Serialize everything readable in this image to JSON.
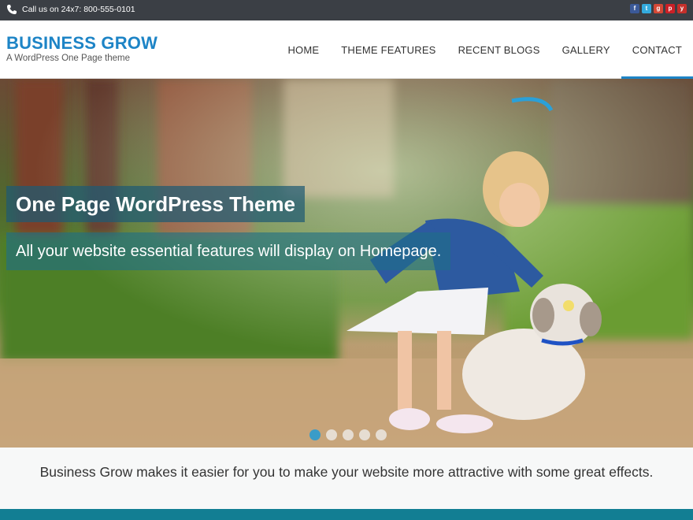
{
  "topbar": {
    "call_text": "Call us on  24x7: 800-555-0101",
    "phone_icon": "phone-icon",
    "social": [
      {
        "name": "facebook-icon",
        "glyph": "f",
        "color": "#3b5998"
      },
      {
        "name": "twitter-icon",
        "glyph": "t",
        "color": "#33aadd"
      },
      {
        "name": "google-plus-icon",
        "glyph": "g",
        "color": "#d34836"
      },
      {
        "name": "pinterest-icon",
        "glyph": "p",
        "color": "#cb2027"
      },
      {
        "name": "youtube-icon",
        "glyph": "y",
        "color": "#c4302b"
      }
    ]
  },
  "header": {
    "logo": "BUSINESS GROW",
    "tagline": "A WordPress One Page theme",
    "nav": [
      {
        "label": "HOME"
      },
      {
        "label": "THEME FEATURES"
      },
      {
        "label": "RECENT BLOGS"
      },
      {
        "label": "GALLERY"
      },
      {
        "label": "CONTACT"
      }
    ],
    "active_index": 4
  },
  "hero": {
    "caption_title": "One Page WordPress Theme",
    "caption_text": "All your website essential features will display on Homepage.",
    "slides": 5,
    "active_slide": 0
  },
  "intro": {
    "text": "Business Grow makes it easier for you to make your website more attractive with some great effects."
  },
  "colors": {
    "accent": "#1d84c6",
    "topbar": "#3b3f45",
    "footer": "#127e93"
  }
}
